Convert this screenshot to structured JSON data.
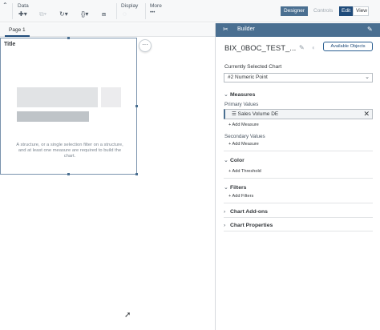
{
  "toolbar": {
    "data_label": "Data",
    "display_label": "Display",
    "more_label": "More",
    "more_icon_text": "•••",
    "designer_label": "Designer",
    "controls_label": "Controls",
    "edit_label": "Edit",
    "view_label": "View"
  },
  "page_tabs": {
    "page1_label": "Page 1"
  },
  "widget": {
    "title": "Title",
    "message": "A structure, or a single selection filter on a structure, and at least one measure are required to build the chart."
  },
  "builder": {
    "title": "Builder",
    "chart_name": "BIX_0BOC_TEST_...",
    "available_objects_label": "Available Objects",
    "currently_selected_chart_label": "Currently Selected Chart",
    "chart_type_icon": "#2",
    "chart_type_value": "Numeric Point",
    "measures_label": "Measures",
    "primary_values_label": "Primary Values",
    "primary_value_item": "Sales Volume DE",
    "add_measure_1": "+ Add Measure",
    "secondary_values_label": "Secondary Values",
    "add_measure_2": "+ Add Measure",
    "color_label": "Color",
    "add_threshold": "+ Add Threshold",
    "filters_label": "Filters",
    "add_filters": "+ Add Filters",
    "chart_addons_label": "Chart Add-ons",
    "chart_properties_label": "Chart Properties"
  },
  "colors": {
    "builder_header": "#4a6f91",
    "edit_active": "#1f4b7a",
    "selection_border": "#7a93ad"
  }
}
